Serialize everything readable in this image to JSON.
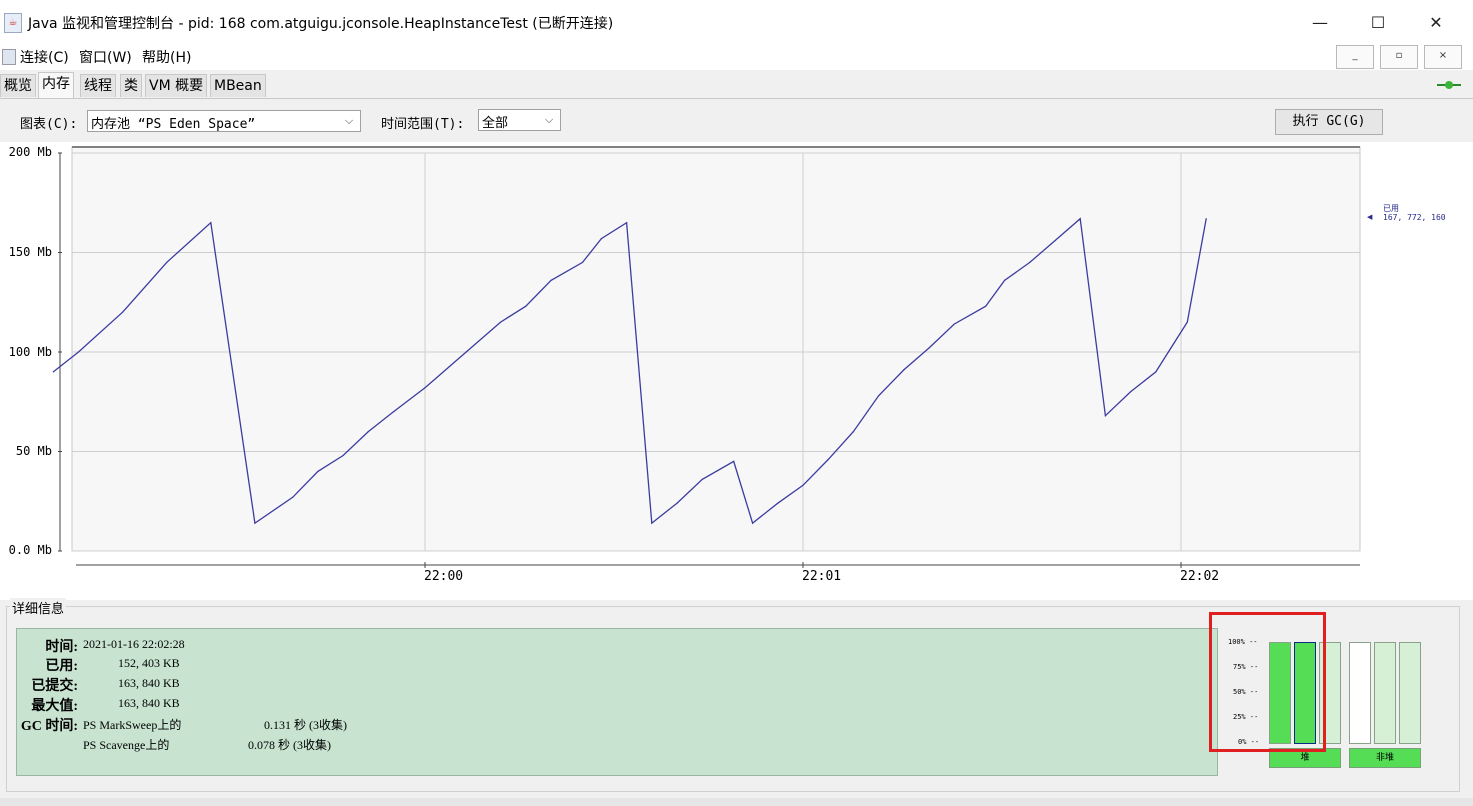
{
  "window": {
    "title": "Java 监视和管理控制台 - pid: 168 com.atguigu.jconsole.HeapInstanceTest (已断开连接)",
    "minimize": "—",
    "maximize": "☐",
    "close": "✕"
  },
  "menu": {
    "items": [
      "连接(C)",
      "窗口(W)",
      "帮助(H)"
    ],
    "inner_buttons": [
      "_",
      "▫",
      "×"
    ]
  },
  "tabs": [
    "概览",
    "内存",
    "线程",
    "类",
    "VM 概要",
    "MBean"
  ],
  "active_tab": "内存",
  "controls": {
    "chart_label": "图表(C):",
    "chart_value": "内存池 “PS Eden Space”",
    "range_label": "时间范围(T):",
    "range_value": "全部",
    "gc_button": "执行 GC(G)"
  },
  "chart_data": {
    "type": "line",
    "ylabels": [
      "200 Mb",
      "150 Mb",
      "100 Mb",
      "50 Mb",
      "0.0 Mb"
    ],
    "yticks": [
      200,
      150,
      100,
      50,
      0
    ],
    "ylim": [
      0,
      200
    ],
    "xlabels": [
      "22:00",
      "22:01",
      "22:02"
    ],
    "series": [
      {
        "name": "已用",
        "last_value": "167, 772, 160",
        "color": "#3c3ca0",
        "x_seconds": [
          -59,
          -55,
          -48,
          -41,
          -34,
          -27,
          -21,
          -17,
          -13,
          -9,
          -5,
          0,
          4,
          8,
          12,
          16,
          20,
          25,
          28,
          32,
          36,
          40,
          44,
          49,
          52,
          56,
          60,
          64,
          68,
          72,
          76,
          80,
          84,
          89,
          92,
          96,
          100,
          104,
          108,
          112,
          116,
          121,
          124
        ],
        "values_mb": [
          90,
          100,
          120,
          145,
          165,
          14,
          27,
          40,
          48,
          60,
          70,
          82,
          93,
          104,
          115,
          123,
          136,
          145,
          157,
          165,
          14,
          24,
          36,
          45,
          14,
          24,
          33,
          46,
          60,
          78,
          91,
          102,
          114,
          123,
          136,
          145,
          156,
          167,
          68,
          80,
          90,
          115,
          167
        ]
      }
    ]
  },
  "details": {
    "section_title": "详细信息",
    "rows": [
      {
        "key": "时间:",
        "value": "2021-01-16 22:02:28"
      },
      {
        "key": "已用:",
        "value": "152, 403 KB"
      },
      {
        "key": "已提交:",
        "value": "163, 840 KB"
      },
      {
        "key": "最大值:",
        "value": "163, 840 KB"
      }
    ],
    "gc_key": "GC 时间:",
    "gc_rows": [
      {
        "name": "PS MarkSweep上的",
        "value": "0.131 秒 (3收集)"
      },
      {
        "name": "PS Scavenge上的",
        "value": "0.078 秒 (3收集)"
      }
    ]
  },
  "pool_bars": {
    "pct_labels": [
      "100% --",
      "75% --",
      "50% --",
      "25% --",
      "0% --"
    ],
    "heap_fill": [
      1.0,
      1.0,
      0.0
    ],
    "nonheap_fill": [
      0.0,
      0.0,
      0.0
    ],
    "heap_label": "堆",
    "nonheap_label": "非堆"
  }
}
